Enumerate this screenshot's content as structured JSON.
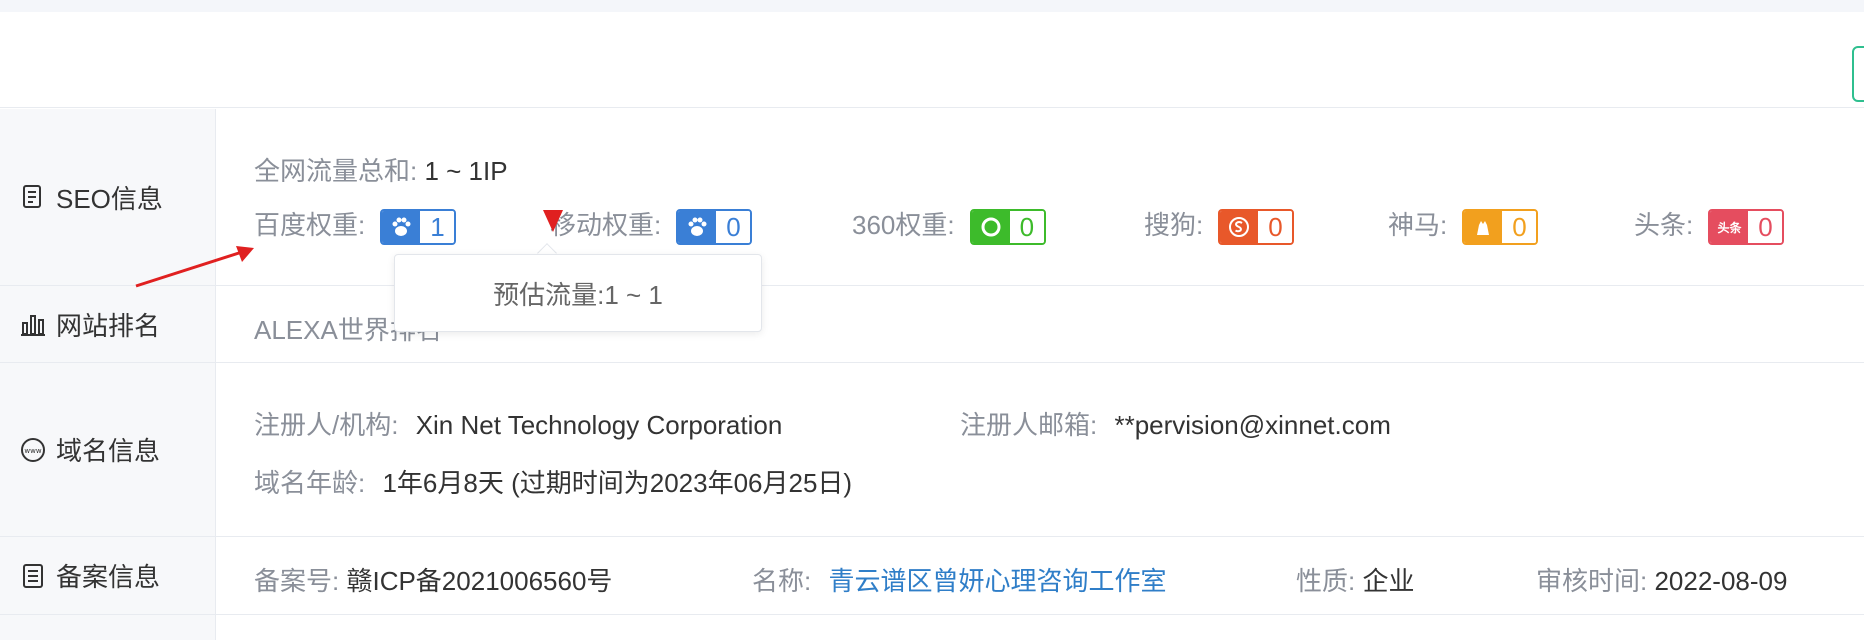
{
  "seo": {
    "label": "SEO信息",
    "total_traffic_key": "全网流量总和:",
    "total_traffic_value": "1 ~ 1IP",
    "weights": [
      {
        "key": "百度权重:",
        "value": "1",
        "color": "#3a7fd6",
        "logo": "paw-icon"
      },
      {
        "key": "移动权重:",
        "value": "0",
        "color": "#3a7fd6",
        "logo": "paw-icon"
      },
      {
        "key": "360权重:",
        "value": "0",
        "color": "#3dbb2b",
        "logo": "360-icon"
      },
      {
        "key": "搜狗:",
        "value": "0",
        "color": "#e8582a",
        "logo": "sogou-icon"
      },
      {
        "key": "神马:",
        "value": "0",
        "color": "#f2a01e",
        "logo": "shenma-icon"
      },
      {
        "key": "头条:",
        "value": "0",
        "color": "#e54d5f",
        "logo": "toutiao-icon",
        "logo_text": "头条"
      }
    ],
    "tooltip": "预估流量:1 ~ 1"
  },
  "rank": {
    "label": "网站排名",
    "alexa_key": "ALEXA世界排名"
  },
  "domain": {
    "label": "域名信息",
    "registrant_key": "注册人/机构:",
    "registrant_value": "Xin Net Technology Corporation",
    "email_key": "注册人邮箱:",
    "email_value": "**pervision@xinnet.com",
    "age_key": "域名年龄:",
    "age_value": "1年6月8天 (过期时间为2023年06月25日)"
  },
  "icp": {
    "label": "备案信息",
    "number_key": "备案号:",
    "number_value": "赣ICP备2021006560号",
    "name_key": "名称:",
    "name_value": "青云谱区曾妍心理咨询工作室",
    "type_key": "性质:",
    "type_value": "企业",
    "date_key": "审核时间:",
    "date_value": "2022-08-09"
  }
}
